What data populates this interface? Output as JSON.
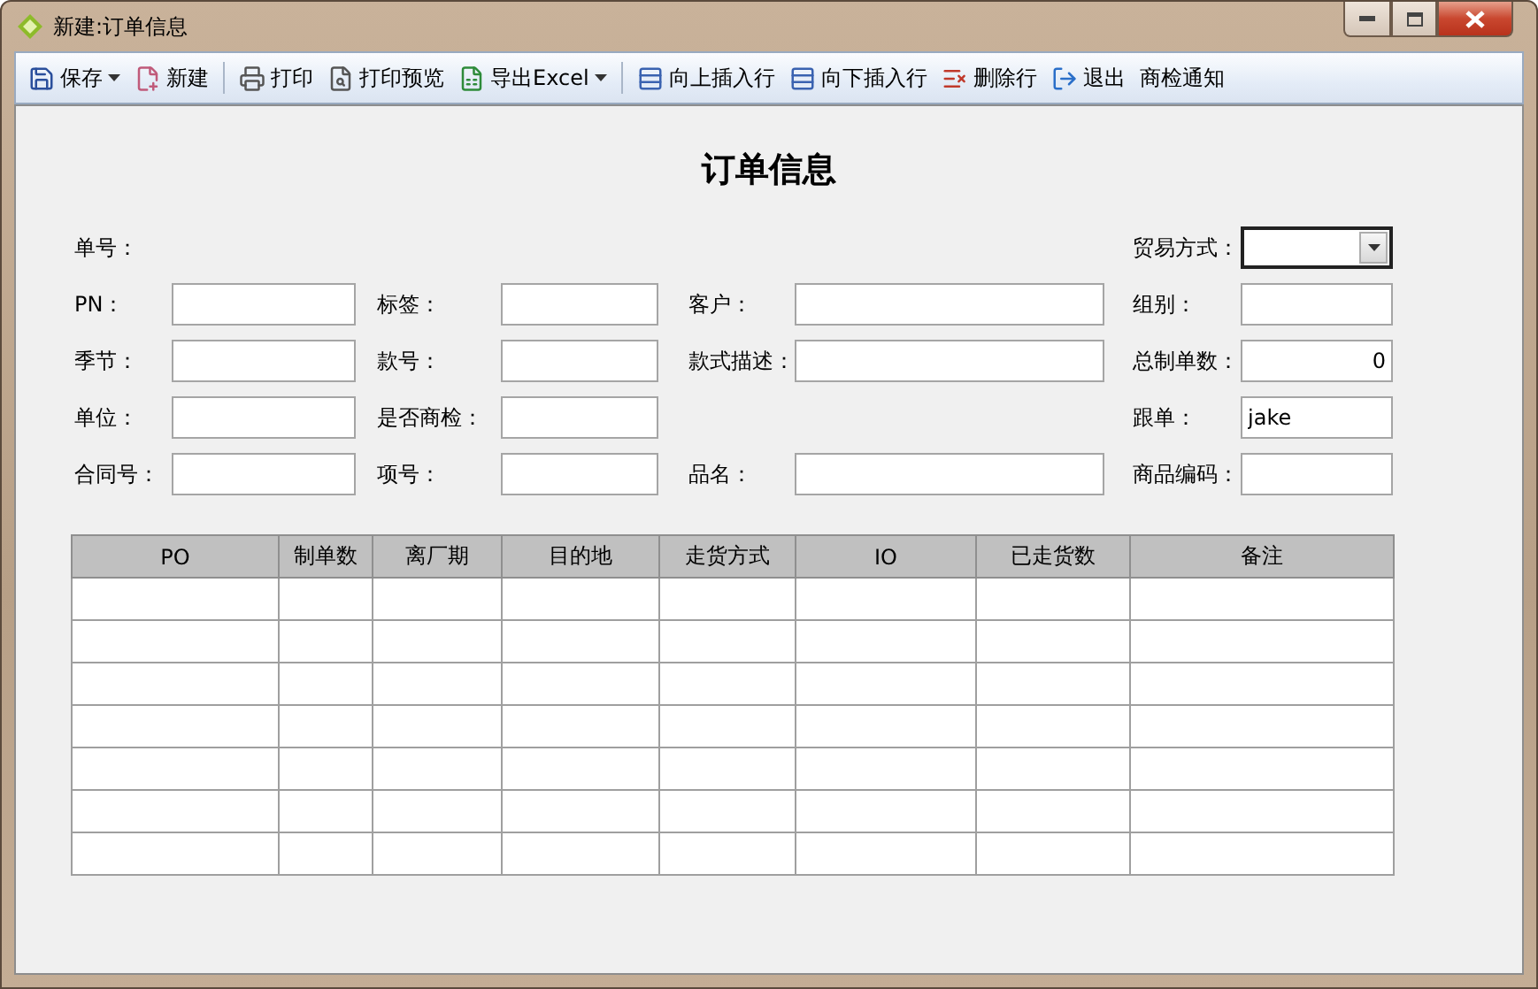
{
  "window": {
    "title": "新建:订单信息"
  },
  "toolbar": [
    {
      "label": "保存",
      "kind": "dropdown"
    },
    {
      "label": "新建",
      "kind": "button"
    },
    {
      "kind": "separator"
    },
    {
      "label": "打印",
      "kind": "button"
    },
    {
      "label": "打印预览",
      "kind": "button"
    },
    {
      "label": "导出Excel",
      "kind": "dropdown"
    },
    {
      "kind": "separator"
    },
    {
      "label": "向上插入行",
      "kind": "button"
    },
    {
      "label": "向下插入行",
      "kind": "button"
    },
    {
      "label": "删除行",
      "kind": "button"
    },
    {
      "label": "退出",
      "kind": "button"
    },
    {
      "label": "商检通知",
      "kind": "button"
    }
  ],
  "form": {
    "title": "订单信息",
    "rows": [
      [
        {
          "kind": "label",
          "label": "单号："
        },
        {
          "kind": "empty"
        },
        {
          "kind": "empty"
        },
        {
          "kind": "combo",
          "label": "贸易方式："
        }
      ],
      [
        {
          "kind": "text",
          "label": "PN："
        },
        {
          "kind": "text",
          "label": "标签："
        },
        {
          "kind": "text",
          "label": "客户："
        },
        {
          "kind": "text",
          "label": "组别："
        }
      ],
      [
        {
          "kind": "text",
          "label": "季节："
        },
        {
          "kind": "text",
          "label": "款号："
        },
        {
          "kind": "text",
          "label": "款式描述："
        },
        {
          "kind": "number",
          "label": "总制单数：",
          "value": "0"
        }
      ],
      [
        {
          "kind": "text",
          "label": "单位："
        },
        {
          "kind": "text",
          "label": "是否商检："
        },
        {
          "kind": "empty"
        },
        {
          "kind": "text",
          "label": "跟单：",
          "value": "jake"
        }
      ],
      [
        {
          "kind": "text",
          "label": "合同号："
        },
        {
          "kind": "text",
          "label": "项号："
        },
        {
          "kind": "text",
          "label": "品名："
        },
        {
          "kind": "text",
          "label": "商品编码："
        }
      ]
    ]
  },
  "table": {
    "columns": [
      "PO",
      "制单数",
      "离厂期",
      "目的地",
      "走货方式",
      "IO",
      "已走货数",
      "备注"
    ]
  }
}
